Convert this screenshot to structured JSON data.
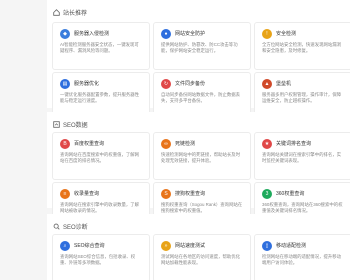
{
  "sections": [
    {
      "title": "站长推荐",
      "icon": "home-icon",
      "cards": [
        {
          "title": "服务器入侵检测",
          "desc": "AI智能检测服务器安全状态，一键发现可疑程序、漏洞风险等问题。",
          "color": "#3b7ddd",
          "icon": "shield-icon"
        },
        {
          "title": "网站安全防护",
          "desc": "提供网站防护、防篡改、防CC攻击等功能，保护网站安全稳定运行。",
          "color": "#2f6fde",
          "icon": "globe-icon"
        },
        {
          "title": "安全检测",
          "desc": "全方位网站安全检测，快速发现网站漏洞和安全隐患，及时修复。",
          "color": "#e8a317",
          "icon": "alert-icon"
        },
        {
          "title": "",
          "desc": "",
          "color": "#e04848",
          "icon": "partial-icon"
        },
        {
          "title": "服务器优化",
          "desc": "一键优化服务器配置参数，提升服务器性能与稳定运行速度。",
          "color": "#2f6fde",
          "icon": "chart-icon"
        },
        {
          "title": "文件同步备份",
          "desc": "自动同步备份网站数据文件，防止数据丢失，支持多平台备份。",
          "color": "#e04848",
          "icon": "sync-icon"
        },
        {
          "title": "堡垒机",
          "desc": "服务器多用户权限管理，操作审计，保障运维安全，防止越权操作。",
          "color": "#d04a2a",
          "icon": "tower-icon"
        },
        {
          "title": "",
          "desc": "",
          "color": "#1eaa5c",
          "icon": "partial-icon"
        }
      ]
    },
    {
      "title": "SEO数据",
      "icon": "seo-icon",
      "cards": [
        {
          "title": "百度权重查询",
          "desc": "查询网站在百度搜索中的权重值，了解网站在百度的排名情况。",
          "color": "#e04848",
          "icon": "baidu-icon"
        },
        {
          "title": "死链检测",
          "desc": "快速检测网站中的死链接，帮助站长及时处理无效链接，提升体验。",
          "color": "#e8741a",
          "icon": "link-icon"
        },
        {
          "title": "关键词排名查询",
          "desc": "查询网站关键词在搜索引擎中的排名，实时监控关键词表现。",
          "color": "#e04848",
          "icon": "rank-icon"
        },
        {
          "title": "",
          "desc": "",
          "color": "#2f6fde",
          "icon": "partial-icon"
        },
        {
          "title": "收录量查询",
          "desc": "查询网站在搜索引擎中的收录数量，了解网站被收录的情况。",
          "color": "#e8741a",
          "icon": "index-icon"
        },
        {
          "title": "搜狗权重查询",
          "desc": "搜狗权重查询（Sogou Rank）查询网站在搜狗搜索中的权重值。",
          "color": "#e8741a",
          "icon": "sogou-icon"
        },
        {
          "title": "360权重查询",
          "desc": "360权重查询，查询网站在360搜索中的权重值及关键词排名情况。",
          "color": "#1eaa5c",
          "icon": "so360-icon"
        },
        {
          "title": "",
          "desc": "",
          "color": "#555555",
          "icon": "partial-icon"
        }
      ]
    },
    {
      "title": "SEO诊断",
      "icon": "diagnose-icon",
      "cards": [
        {
          "title": "SEO综合查询",
          "desc": "查询网站SEO综合信息，包括收录、权重、外链等多项数据。",
          "color": "#2f6fde",
          "icon": "search-icon"
        },
        {
          "title": "网站速度测试",
          "desc": "测试网站在各地区的访问速度，帮助优化网站加载性能表现。",
          "color": "#e8a317",
          "icon": "speed-icon"
        },
        {
          "title": "移动适配检测",
          "desc": "检测网站在移动端的适配情况，提升移动端用户访问体验。",
          "color": "#2f6fde",
          "icon": "mobile-icon"
        },
        {
          "title": "",
          "desc": "",
          "color": "#d04a2a",
          "icon": "partial-icon"
        }
      ]
    }
  ]
}
